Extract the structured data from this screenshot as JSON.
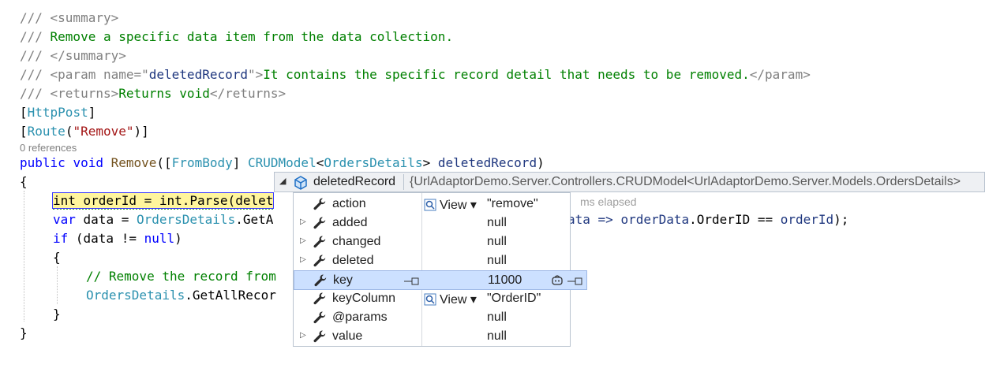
{
  "code_lines": [
    {
      "id": "l1",
      "text": "/// <summary>"
    },
    {
      "id": "l2a",
      "text": "/// "
    },
    {
      "id": "l2b",
      "text": "Remove a specific data item from the data collection."
    },
    {
      "id": "l3",
      "text": "/// </summary>"
    },
    {
      "id": "l4a",
      "text": "/// <param name=\""
    },
    {
      "id": "l4b",
      "text": "deletedRecord"
    },
    {
      "id": "l4c",
      "text": "\">"
    },
    {
      "id": "l4d",
      "text": "It contains the specific record detail that needs to be removed."
    },
    {
      "id": "l4e",
      "text": "</param>"
    },
    {
      "id": "l5a",
      "text": "/// <returns>"
    },
    {
      "id": "l5b",
      "text": "Returns void"
    },
    {
      "id": "l5c",
      "text": "</returns>"
    }
  ],
  "attrs": {
    "open": "[",
    "httppost": "HttpPost",
    "close": "]",
    "route": "Route",
    "paren_open": "(",
    "route_value": "\"Remove\"",
    "paren_close": ")]"
  },
  "references": "0 references",
  "signature": {
    "public": "public",
    "void": "void",
    "method": "Remove",
    "open": "([",
    "frombody": "FromBody",
    "close": "] ",
    "crud": "CRUDModel",
    "lt": "<",
    "orders": "OrdersDetails",
    "gt": "> ",
    "param": "deletedRecord",
    "end": ")"
  },
  "body": {
    "brace_open": "{",
    "line1": "int orderId = int.Parse(delet",
    "line2_var": "var",
    "line2_data": " data = ",
    "line2_orders": "OrdersDetails",
    "line2_rest": ".GetA",
    "line2_tail_a": "ata => ",
    "line2_tail_b": "orderData",
    "line2_tail_c": ".OrderID == ",
    "line2_tail_d": "orderId",
    "line2_tail_e": ");",
    "line3_if": "if",
    "line3_rest": " (data != ",
    "line3_null": "null",
    "line3_end": ")",
    "brace_inner_open": "{",
    "comment": "// Remove the record from",
    "line5_orders": "OrdersDetails",
    "line5_rest": ".GetAllRecor",
    "brace_inner_close": "}",
    "brace_close": "}"
  },
  "datatip": {
    "name": "deletedRecord",
    "type": "{UrlAdaptorDemo.Server.Controllers.CRUDModel<UrlAdaptorDemo.Server.Models.OrdersDetails>",
    "elapsed": "ms elapsed",
    "view_label": "View",
    "rows": [
      {
        "name": "action",
        "value": "\"remove\"",
        "expandable": false,
        "view": true
      },
      {
        "name": "added",
        "value": "null",
        "expandable": true,
        "view": false
      },
      {
        "name": "changed",
        "value": "null",
        "expandable": true,
        "view": false
      },
      {
        "name": "deleted",
        "value": "null",
        "expandable": true,
        "view": false
      },
      {
        "name": "key",
        "value": "11000",
        "expandable": false,
        "view": false,
        "selected": true
      },
      {
        "name": "keyColumn",
        "value": "\"OrderID\"",
        "expandable": false,
        "view": true
      },
      {
        "name": "@params",
        "value": "null",
        "expandable": false,
        "view": false
      },
      {
        "name": "value",
        "value": "null",
        "expandable": true,
        "view": false
      }
    ]
  }
}
